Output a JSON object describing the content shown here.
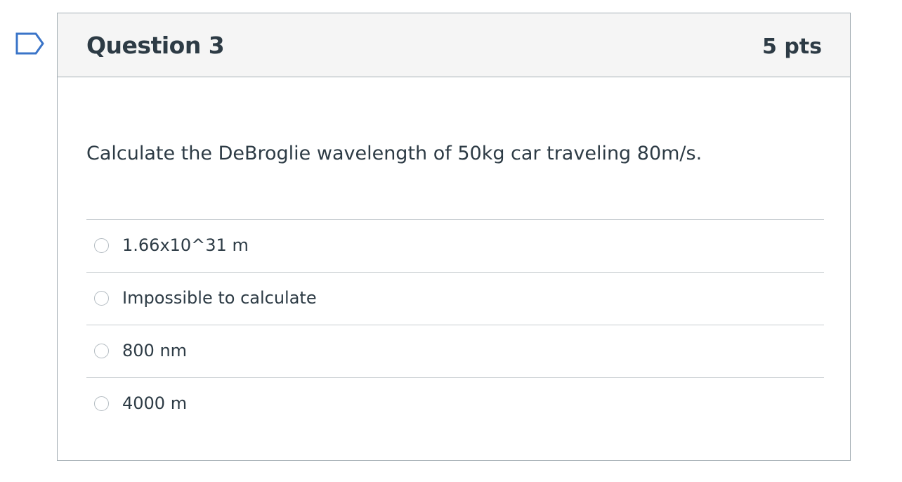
{
  "question": {
    "title": "Question 3",
    "points": "5 pts",
    "text": "Calculate the DeBroglie wavelength of 50kg car traveling 80m/s.",
    "flag_icon": "bookmark-flag-icon"
  },
  "answers": [
    {
      "label": "1.66x10^31 m",
      "selected": false
    },
    {
      "label": "Impossible to calculate",
      "selected": false
    },
    {
      "label": "800 nm",
      "selected": false
    },
    {
      "label": "4000 m",
      "selected": false
    }
  ],
  "colors": {
    "text": "#2d3b45",
    "header_bg": "#f5f5f5",
    "border": "#a5afb5",
    "flag": "#3a74c8"
  }
}
